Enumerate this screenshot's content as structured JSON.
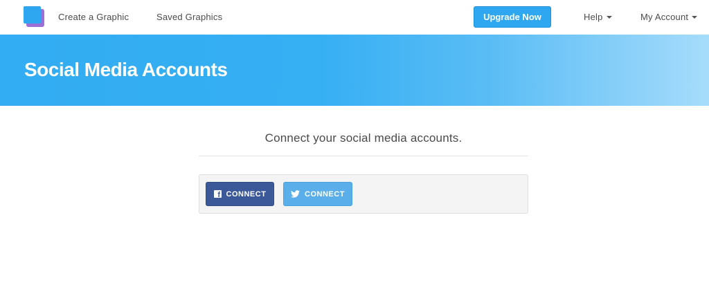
{
  "nav": {
    "create_label": "Create a Graphic",
    "saved_label": "Saved Graphics",
    "upgrade_label": "Upgrade Now",
    "help_label": "Help",
    "account_label": "My Account"
  },
  "banner": {
    "title": "Social Media Accounts"
  },
  "main": {
    "subtitle": "Connect your social media accounts.",
    "facebook_button_label": "CONNECT",
    "twitter_button_label": "CONNECT"
  },
  "icons": {
    "logo": "app-logo-icon",
    "facebook": "facebook-icon",
    "twitter": "twitter-icon",
    "caret": "chevron-down-icon"
  },
  "colors": {
    "accent": "#2ea7f0",
    "facebook": "#3b5998",
    "twitter": "#5aaee9"
  }
}
